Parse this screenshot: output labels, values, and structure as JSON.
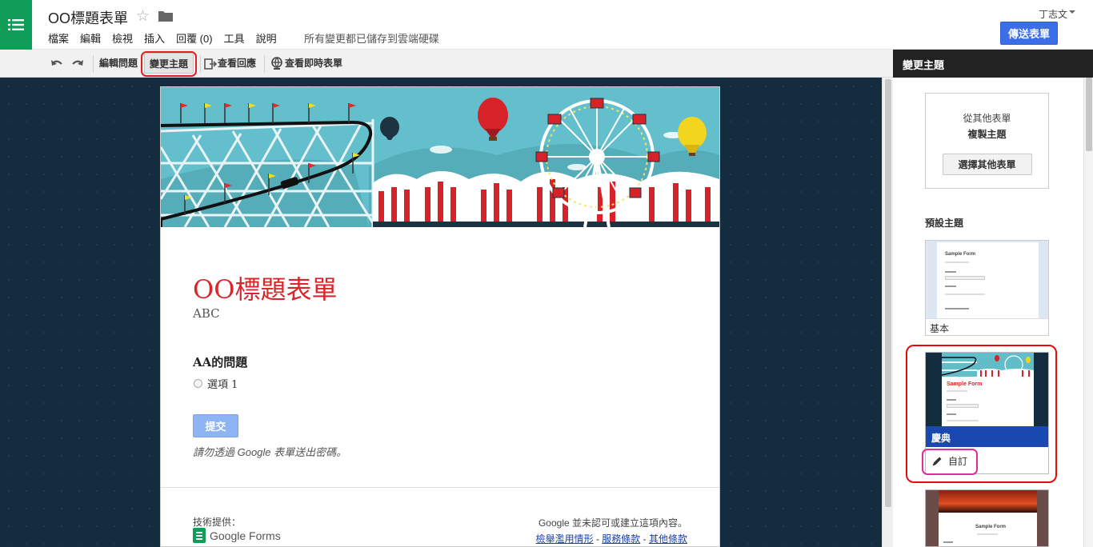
{
  "header": {
    "doc_title": "OO標題表單",
    "menu": [
      "檔案",
      "編輯",
      "檢視",
      "插入",
      "回覆 (0)",
      "工具",
      "說明"
    ],
    "save_status": "所有變更都已儲存到雲端硬碟",
    "user_name": "丁志文",
    "send_label": "傳送表單"
  },
  "toolbar": {
    "edit_questions": "編輯問題",
    "change_theme": "變更主題",
    "view_responses": "查看回應",
    "view_live_form": "查看即時表單"
  },
  "form": {
    "title": "OO標題表單",
    "description": "ABC",
    "question_title": "AA的問題",
    "option_1": "選項 1",
    "submit_label": "提交",
    "password_note": "請勿透過 Google 表單送出密碼。",
    "powered_by": "技術提供：",
    "logo_google": "Google",
    "logo_forms": "Forms",
    "disclaimer": "Google 並未認可或建立這項內容。",
    "link_abuse": "檢舉濫用情形",
    "link_terms": "服務條款",
    "link_other": "其他條款",
    "link_sep": " - "
  },
  "theme_panel": {
    "title": "變更主題",
    "copy_line1": "從其他表單",
    "copy_line2": "複製主題",
    "choose_button": "選擇其他表單",
    "preset_heading": "預設主題",
    "themes": [
      {
        "label": "基本",
        "selected": false
      },
      {
        "label": "慶典",
        "selected": true
      },
      {
        "label": "",
        "selected": false
      }
    ],
    "customize_label": "自訂",
    "thumb_sample_title": "Sample Form",
    "accent_color": "#1848b0"
  },
  "colors": {
    "title_red": "#d8262b",
    "send_blue": "#3b6ee8",
    "forms_green": "#0f9d58",
    "highlight_red": "#e40d0d",
    "highlight_pink": "#e02b98"
  }
}
